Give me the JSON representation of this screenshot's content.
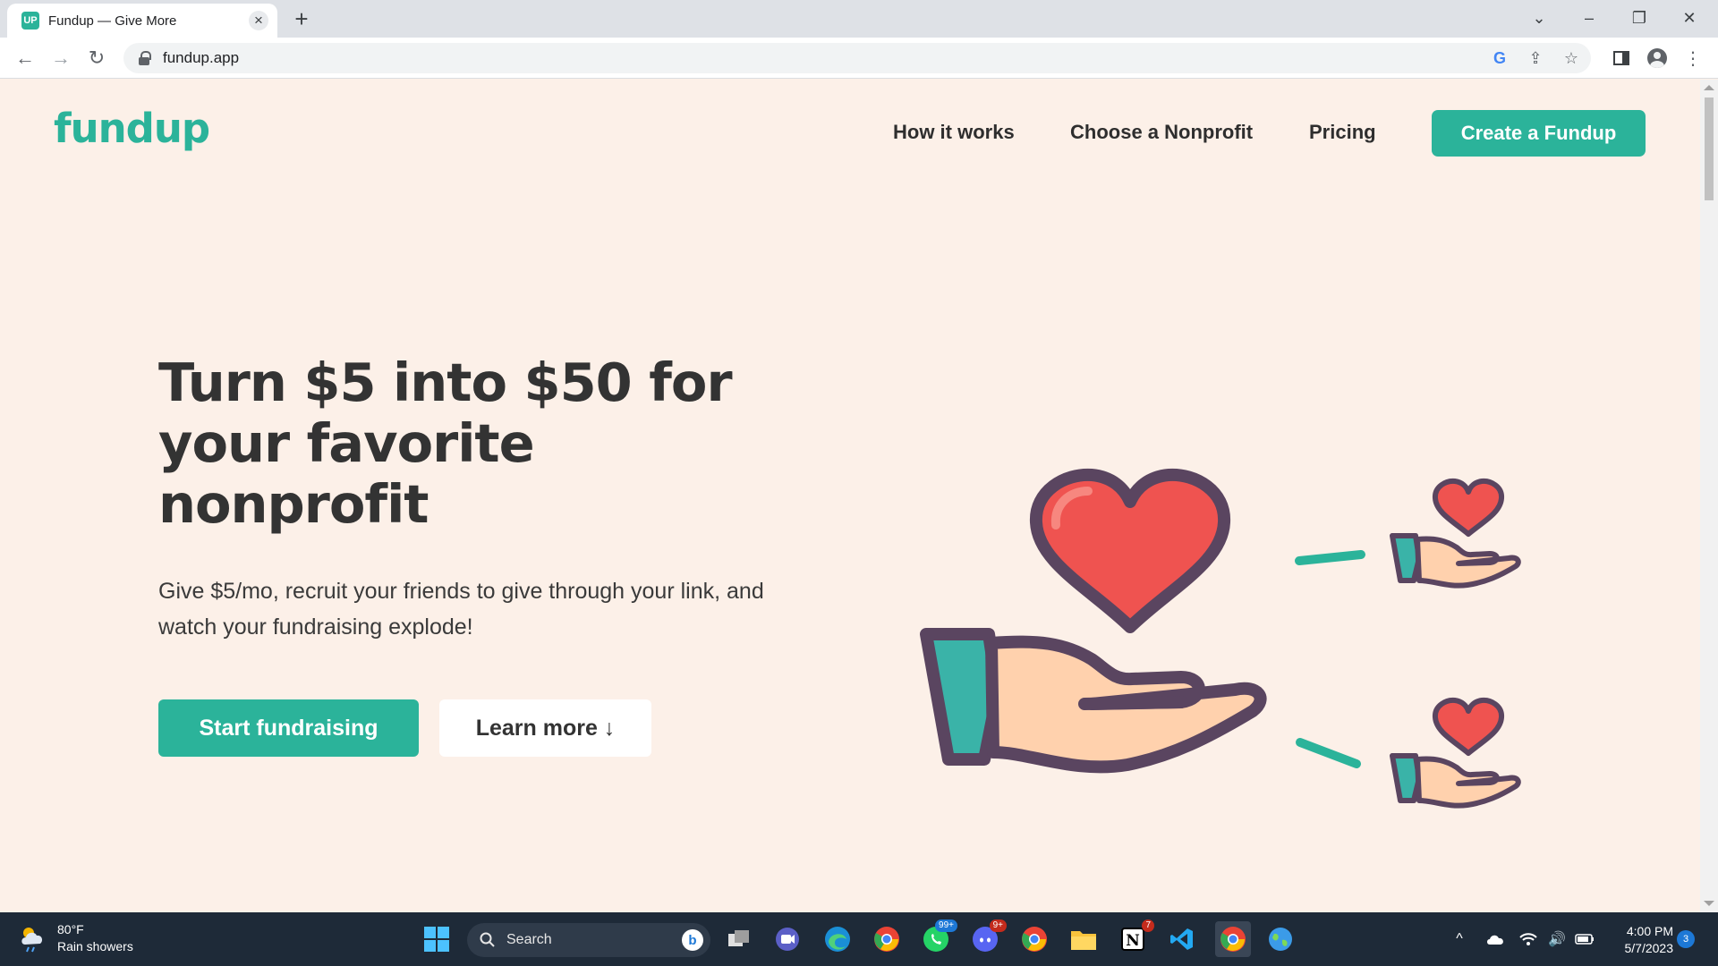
{
  "browser": {
    "tab_title": "Fundup — Give More",
    "tab_favicon_text": "UP",
    "url": "fundup.app"
  },
  "site": {
    "logo": "fundup",
    "nav": [
      "How it works",
      "Choose a Nonprofit",
      "Pricing"
    ],
    "cta": "Create a Fundup"
  },
  "hero": {
    "title": "Turn $5 into $50 for your favorite nonprofit",
    "subtitle": "Give $5/mo, recruit your friends to give through your link, and watch your fundraising explode!",
    "primary_button": "Start fundraising",
    "secondary_button": "Learn more ↓"
  },
  "colors": {
    "brand": "#2bb39a",
    "page_bg": "#fcf0e8",
    "heart": "#ef5350",
    "outline": "#5a4560",
    "skin": "#ffd1ad"
  },
  "taskbar": {
    "weather_temp": "80°F",
    "weather_desc": "Rain showers",
    "search_label": "Search",
    "time": "4:00 PM",
    "date": "5/7/2023",
    "notification_count": "3",
    "badges": {
      "whatsapp": "99+",
      "discord": "9+",
      "notion": "7"
    }
  }
}
